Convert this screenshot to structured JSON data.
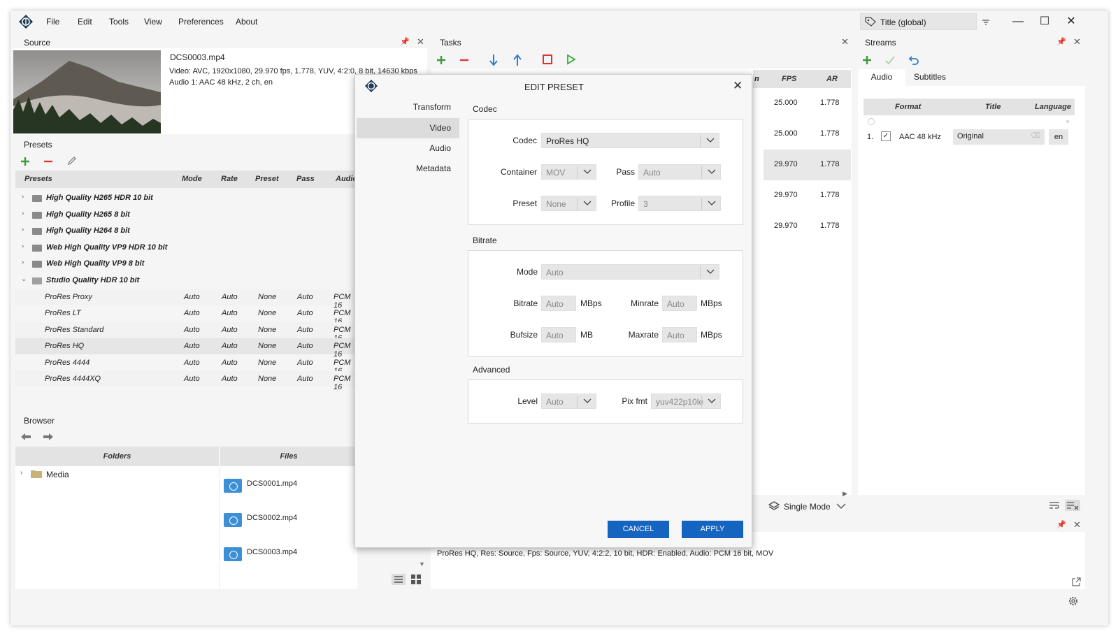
{
  "app": {
    "menu": [
      "File",
      "Edit",
      "Tools",
      "View",
      "Preferences",
      "About"
    ],
    "title_combo": "Title  (global)"
  },
  "source": {
    "title": "Source",
    "filename": "DCS0003.mp4",
    "video_info": "Video: AVC, 1920x1080, 29.970 fps, 1.778, YUV, 4:2:0, 8 bit, 14630 kbps",
    "audio_info": "Audio 1: AAC  48 kHz, 2 ch, en"
  },
  "presets": {
    "title": "Presets",
    "columns": [
      "Presets",
      "Mode",
      "Rate",
      "Preset",
      "Pass",
      "Audio"
    ],
    "folders": [
      "High Quality H265 HDR 10 bit",
      "High Quality H265 8 bit",
      "High Quality H264 8 bit",
      "Web High Quality VP9 HDR 10 bit",
      "Web High Quality VP9 8 bit",
      "Studio Quality HDR 10 bit"
    ],
    "items": [
      {
        "name": "ProRes Proxy",
        "mode": "Auto",
        "rate": "Auto",
        "preset": "None",
        "pass": "Auto",
        "audio": "PCM 16"
      },
      {
        "name": "ProRes LT",
        "mode": "Auto",
        "rate": "Auto",
        "preset": "None",
        "pass": "Auto",
        "audio": "PCM 16"
      },
      {
        "name": "ProRes Standard",
        "mode": "Auto",
        "rate": "Auto",
        "preset": "None",
        "pass": "Auto",
        "audio": "PCM 16"
      },
      {
        "name": "ProRes HQ",
        "mode": "Auto",
        "rate": "Auto",
        "preset": "None",
        "pass": "Auto",
        "audio": "PCM 16"
      },
      {
        "name": "ProRes 4444",
        "mode": "Auto",
        "rate": "Auto",
        "preset": "None",
        "pass": "Auto",
        "audio": "PCM 16"
      },
      {
        "name": "ProRes 4444XQ",
        "mode": "Auto",
        "rate": "Auto",
        "preset": "None",
        "pass": "Auto",
        "audio": "PCM 16"
      }
    ]
  },
  "browser": {
    "title": "Browser",
    "folders_header": "Folders",
    "files_header": "Files",
    "folder": "Media",
    "files": [
      "DCS0001.mp4",
      "DCS0002.mp4",
      "DCS0003.mp4"
    ]
  },
  "tasks": {
    "title": "Tasks",
    "partial_col": "n",
    "columns": [
      "FPS",
      "AR"
    ],
    "rows": [
      {
        "fps": "25.000",
        "ar": "1.778"
      },
      {
        "fps": "25.000",
        "ar": "1.778"
      },
      {
        "fps": "29.970",
        "ar": "1.778"
      },
      {
        "fps": "29.970",
        "ar": "1.778"
      },
      {
        "fps": "29.970",
        "ar": "1.778"
      }
    ],
    "mode_label": "Single Mode",
    "status_text": "ProRes HQ, Res: Source, Fps: Source, YUV, 4:2:2, 10 bit, HDR: Enabled, Audio: PCM 16 bit, MOV"
  },
  "streams": {
    "title": "Streams",
    "tabs": [
      "Audio",
      "Subtitles"
    ],
    "columns": [
      "Format",
      "Title",
      "Language"
    ],
    "row": {
      "index": "1.",
      "format": "AAC  48 kHz",
      "title": "Original",
      "language": "en"
    }
  },
  "dialog": {
    "title": "EDIT PRESET",
    "nav": [
      "Transform",
      "Video",
      "Audio",
      "Metadata"
    ],
    "codec_group": "Codec",
    "codec_label": "Codec",
    "codec_value": "ProRes HQ",
    "container_label": "Container",
    "container_value": "MOV",
    "pass_label": "Pass",
    "pass_value": "Auto",
    "preset_label": "Preset",
    "preset_value": "None",
    "profile_label": "Profile",
    "profile_value": "3",
    "bitrate_group": "Bitrate",
    "mode_label": "Mode",
    "mode_value": "Auto",
    "bitrate_label": "Bitrate",
    "bitrate_value": "Auto",
    "bitrate_unit": "MBps",
    "minrate_label": "Minrate",
    "minrate_value": "Auto",
    "minrate_unit": "MBps",
    "bufsize_label": "Bufsize",
    "bufsize_value": "Auto",
    "bufsize_unit": "MB",
    "maxrate_label": "Maxrate",
    "maxrate_value": "Auto",
    "maxrate_unit": "MBps",
    "advanced_group": "Advanced",
    "level_label": "Level",
    "level_value": "Auto",
    "pixfmt_label": "Pix fmt",
    "pixfmt_value": "yuv422p10le",
    "cancel": "CANCEL",
    "apply": "APPLY"
  },
  "colors": {
    "accent": "#1565c0",
    "add": "#3c9a3c",
    "remove": "#d83a3a",
    "stop": "#e03030",
    "play": "#3caa3c",
    "arrow": "#2c7fc9"
  }
}
